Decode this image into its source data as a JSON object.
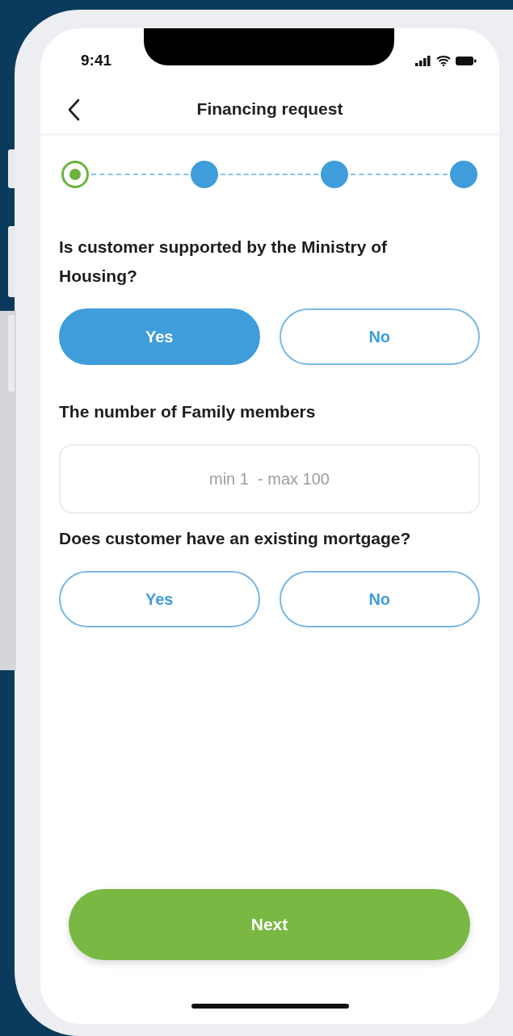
{
  "status_bar": {
    "time": "9:41"
  },
  "header": {
    "title": "Financing request"
  },
  "steps": [
    {
      "current": true
    },
    {
      "current": false
    },
    {
      "current": false
    },
    {
      "current": false
    }
  ],
  "questions": [
    {
      "kind": "choice",
      "text": "Is customer supported by the Ministry of Housing?",
      "options": [
        {
          "label": "Yes",
          "selected": true
        },
        {
          "label": "No",
          "selected": false
        }
      ]
    },
    {
      "kind": "number",
      "text": "The number of Family members",
      "placeholder": "min 1  - max 100"
    },
    {
      "kind": "choice",
      "text": "Does customer have an existing mortgage?",
      "options": [
        {
          "label": "Yes",
          "selected": false
        },
        {
          "label": "No",
          "selected": false
        }
      ]
    }
  ],
  "next_button": {
    "label": "Next"
  }
}
